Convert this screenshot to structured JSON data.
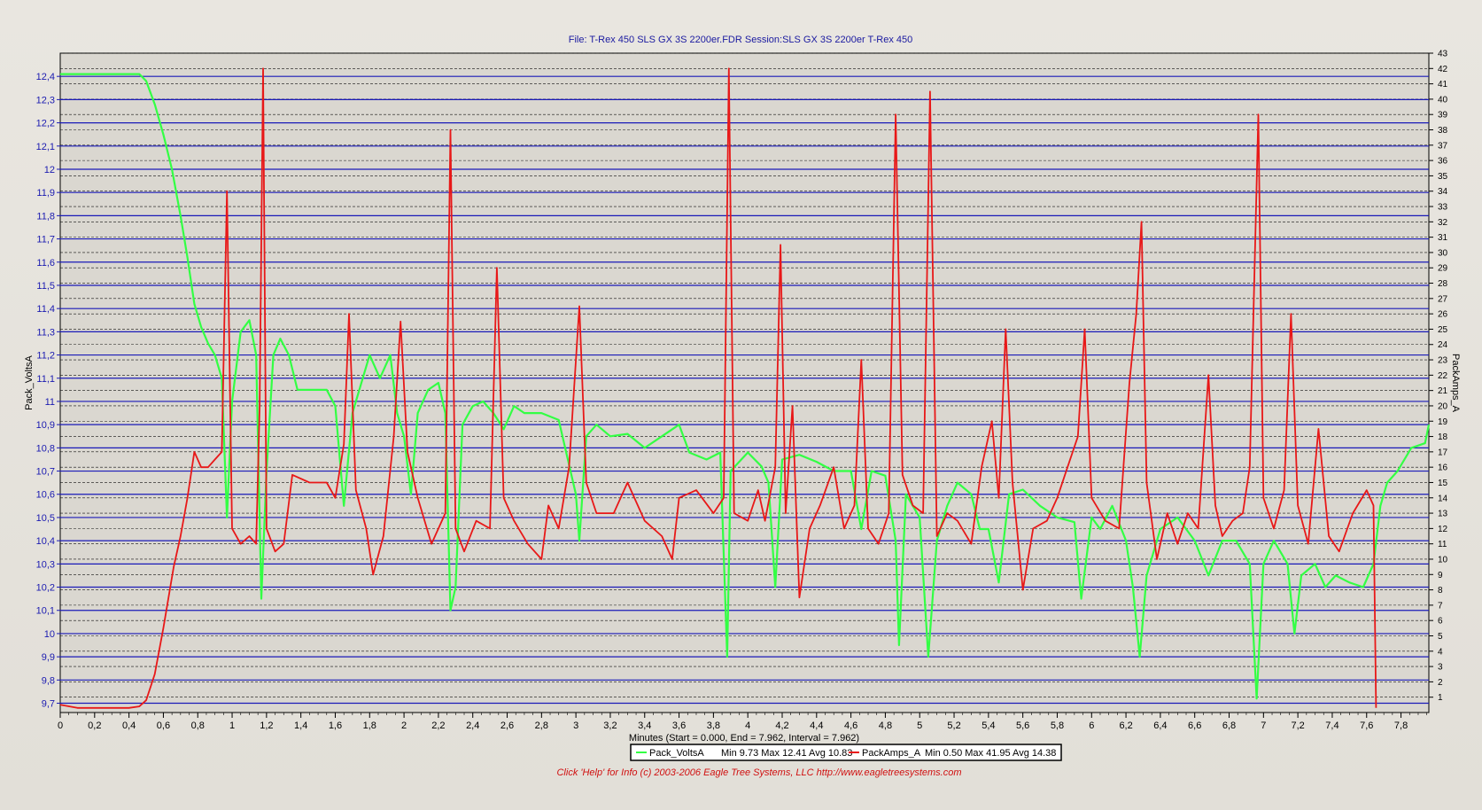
{
  "chart_data": {
    "type": "line",
    "title": "File: T-Rex 450 SLS GX 3S 2200er.FDR   Session:SLS GX 3S 2200er T-Rex 450",
    "xlabel": "Minutes (Start = 0.000,  End = 7.962,  Interval =  7.962)",
    "ylabel_left": "Pack_VoltsA",
    "ylabel_right": "PackAmps_A",
    "xlim": [
      0,
      7.962
    ],
    "ylim_left": [
      9.66,
      12.5
    ],
    "ylim_right": [
      0,
      43
    ],
    "x_ticks": [
      "0",
      "0,2",
      "0,4",
      "0,6",
      "0,8",
      "1",
      "1,2",
      "1,4",
      "1,6",
      "1,8",
      "2",
      "2,2",
      "2,4",
      "2,6",
      "2,8",
      "3",
      "3,2",
      "3,4",
      "3,6",
      "3,8",
      "4",
      "4,2",
      "4,4",
      "4,6",
      "4,8",
      "5",
      "5,2",
      "5,4",
      "5,6",
      "5,8",
      "6",
      "6,2",
      "6,4",
      "6,6",
      "6,8",
      "7",
      "7,2",
      "7,4",
      "7,6",
      "7,8"
    ],
    "y_left_ticks": [
      "12,4",
      "12,3",
      "12,2",
      "12,1",
      "12",
      "11,9",
      "11,8",
      "11,7",
      "11,6",
      "11,5",
      "11,4",
      "11,3",
      "11,2",
      "11,1",
      "11",
      "10,9",
      "10,8",
      "10,7",
      "10,6",
      "10,5",
      "10,4",
      "10,3",
      "10,2",
      "10,1",
      "10",
      "9,9",
      "9,8",
      "9,7"
    ],
    "y_right_ticks": [
      "43",
      "42",
      "41",
      "40",
      "39",
      "38",
      "37",
      "36",
      "35",
      "34",
      "33",
      "32",
      "31",
      "30",
      "29",
      "28",
      "27",
      "26",
      "25",
      "24",
      "23",
      "22",
      "21",
      "20",
      "19",
      "18",
      "17",
      "16",
      "15",
      "14",
      "13",
      "12",
      "11",
      "10",
      "9",
      "8",
      "7",
      "6",
      "5",
      "4",
      "3",
      "2",
      "1"
    ],
    "grid": true,
    "legend_position": "bottom-center",
    "series": [
      {
        "name": "Pack_VoltsA",
        "axis": "left",
        "color": "#33ff44",
        "stats": "Min 9.73 Max 12.41 Avg 10.83",
        "points": [
          [
            0,
            12.41
          ],
          [
            0.3,
            12.41
          ],
          [
            0.46,
            12.41
          ],
          [
            0.5,
            12.38
          ],
          [
            0.55,
            12.28
          ],
          [
            0.6,
            12.15
          ],
          [
            0.65,
            12.0
          ],
          [
            0.7,
            11.8
          ],
          [
            0.74,
            11.62
          ],
          [
            0.78,
            11.42
          ],
          [
            0.82,
            11.32
          ],
          [
            0.86,
            11.25
          ],
          [
            0.9,
            11.2
          ],
          [
            0.94,
            11.1
          ],
          [
            0.97,
            10.5
          ],
          [
            1.0,
            11.0
          ],
          [
            1.05,
            11.3
          ],
          [
            1.1,
            11.35
          ],
          [
            1.14,
            11.2
          ],
          [
            1.17,
            10.15
          ],
          [
            1.2,
            10.7
          ],
          [
            1.24,
            11.2
          ],
          [
            1.28,
            11.27
          ],
          [
            1.33,
            11.2
          ],
          [
            1.38,
            11.05
          ],
          [
            1.45,
            11.05
          ],
          [
            1.55,
            11.05
          ],
          [
            1.6,
            10.98
          ],
          [
            1.65,
            10.55
          ],
          [
            1.7,
            10.95
          ],
          [
            1.76,
            11.1
          ],
          [
            1.8,
            11.2
          ],
          [
            1.86,
            11.1
          ],
          [
            1.92,
            11.2
          ],
          [
            1.96,
            10.95
          ],
          [
            2.0,
            10.85
          ],
          [
            2.04,
            10.6
          ],
          [
            2.08,
            10.95
          ],
          [
            2.14,
            11.05
          ],
          [
            2.2,
            11.08
          ],
          [
            2.24,
            10.95
          ],
          [
            2.27,
            10.1
          ],
          [
            2.3,
            10.2
          ],
          [
            2.34,
            10.9
          ],
          [
            2.4,
            10.98
          ],
          [
            2.46,
            11.0
          ],
          [
            2.52,
            10.95
          ],
          [
            2.58,
            10.88
          ],
          [
            2.64,
            10.98
          ],
          [
            2.7,
            10.95
          ],
          [
            2.8,
            10.95
          ],
          [
            2.9,
            10.92
          ],
          [
            3.0,
            10.6
          ],
          [
            3.02,
            10.4
          ],
          [
            3.06,
            10.85
          ],
          [
            3.12,
            10.9
          ],
          [
            3.2,
            10.85
          ],
          [
            3.3,
            10.86
          ],
          [
            3.4,
            10.8
          ],
          [
            3.5,
            10.85
          ],
          [
            3.6,
            10.9
          ],
          [
            3.66,
            10.78
          ],
          [
            3.76,
            10.75
          ],
          [
            3.84,
            10.78
          ],
          [
            3.88,
            9.9
          ],
          [
            3.9,
            10.7
          ],
          [
            4.0,
            10.78
          ],
          [
            4.08,
            10.72
          ],
          [
            4.12,
            10.65
          ],
          [
            4.16,
            10.2
          ],
          [
            4.2,
            10.75
          ],
          [
            4.3,
            10.77
          ],
          [
            4.4,
            10.74
          ],
          [
            4.5,
            10.7
          ],
          [
            4.6,
            10.7
          ],
          [
            4.66,
            10.45
          ],
          [
            4.72,
            10.7
          ],
          [
            4.8,
            10.68
          ],
          [
            4.86,
            10.4
          ],
          [
            4.88,
            9.95
          ],
          [
            4.92,
            10.6
          ],
          [
            5.0,
            10.5
          ],
          [
            5.05,
            9.9
          ],
          [
            5.1,
            10.4
          ],
          [
            5.16,
            10.55
          ],
          [
            5.22,
            10.65
          ],
          [
            5.3,
            10.6
          ],
          [
            5.35,
            10.45
          ],
          [
            5.4,
            10.45
          ],
          [
            5.46,
            10.22
          ],
          [
            5.52,
            10.6
          ],
          [
            5.6,
            10.62
          ],
          [
            5.7,
            10.55
          ],
          [
            5.8,
            10.5
          ],
          [
            5.9,
            10.48
          ],
          [
            5.94,
            10.15
          ],
          [
            6.0,
            10.5
          ],
          [
            6.05,
            10.45
          ],
          [
            6.12,
            10.55
          ],
          [
            6.2,
            10.4
          ],
          [
            6.24,
            10.2
          ],
          [
            6.28,
            9.9
          ],
          [
            6.32,
            10.25
          ],
          [
            6.4,
            10.45
          ],
          [
            6.5,
            10.5
          ],
          [
            6.6,
            10.4
          ],
          [
            6.68,
            10.25
          ],
          [
            6.76,
            10.4
          ],
          [
            6.84,
            10.4
          ],
          [
            6.92,
            10.3
          ],
          [
            6.96,
            9.72
          ],
          [
            7.0,
            10.3
          ],
          [
            7.06,
            10.4
          ],
          [
            7.14,
            10.3
          ],
          [
            7.18,
            10.0
          ],
          [
            7.22,
            10.25
          ],
          [
            7.3,
            10.3
          ],
          [
            7.36,
            10.2
          ],
          [
            7.42,
            10.25
          ],
          [
            7.5,
            10.22
          ],
          [
            7.58,
            10.2
          ],
          [
            7.64,
            10.3
          ],
          [
            7.68,
            10.55
          ],
          [
            7.72,
            10.65
          ],
          [
            7.78,
            10.7
          ],
          [
            7.86,
            10.8
          ],
          [
            7.94,
            10.82
          ],
          [
            7.962,
            10.9
          ]
        ]
      },
      {
        "name": "PackAmps_A",
        "axis": "right",
        "color": "#e81818",
        "stats": "Min 0.50 Max 41.95 Avg 14.38",
        "points": [
          [
            0,
            0.5
          ],
          [
            0.1,
            0.3
          ],
          [
            0.2,
            0.3
          ],
          [
            0.3,
            0.3
          ],
          [
            0.4,
            0.3
          ],
          [
            0.46,
            0.4
          ],
          [
            0.5,
            0.8
          ],
          [
            0.55,
            2.5
          ],
          [
            0.6,
            5.5
          ],
          [
            0.66,
            9.5
          ],
          [
            0.7,
            11.5
          ],
          [
            0.74,
            14.0
          ],
          [
            0.78,
            17.0
          ],
          [
            0.82,
            16.0
          ],
          [
            0.86,
            16.0
          ],
          [
            0.9,
            16.5
          ],
          [
            0.94,
            17.0
          ],
          [
            0.97,
            34.0
          ],
          [
            1.0,
            12.0
          ],
          [
            1.05,
            11.0
          ],
          [
            1.1,
            11.5
          ],
          [
            1.14,
            11.0
          ],
          [
            1.16,
            20.0
          ],
          [
            1.18,
            42.0
          ],
          [
            1.2,
            12.0
          ],
          [
            1.25,
            10.5
          ],
          [
            1.3,
            11.0
          ],
          [
            1.35,
            15.5
          ],
          [
            1.45,
            15.0
          ],
          [
            1.55,
            15.0
          ],
          [
            1.6,
            14.0
          ],
          [
            1.65,
            17.5
          ],
          [
            1.68,
            26.0
          ],
          [
            1.72,
            14.5
          ],
          [
            1.78,
            12.0
          ],
          [
            1.82,
            9.0
          ],
          [
            1.88,
            11.5
          ],
          [
            1.94,
            18.0
          ],
          [
            1.98,
            25.5
          ],
          [
            2.02,
            17.0
          ],
          [
            2.08,
            14.0
          ],
          [
            2.16,
            11.0
          ],
          [
            2.24,
            13.0
          ],
          [
            2.27,
            38.0
          ],
          [
            2.3,
            12.0
          ],
          [
            2.35,
            10.5
          ],
          [
            2.42,
            12.5
          ],
          [
            2.5,
            12.0
          ],
          [
            2.54,
            29.0
          ],
          [
            2.58,
            14.0
          ],
          [
            2.64,
            12.5
          ],
          [
            2.72,
            11.0
          ],
          [
            2.8,
            10.0
          ],
          [
            2.84,
            13.5
          ],
          [
            2.9,
            12.0
          ],
          [
            2.96,
            16.0
          ],
          [
            3.02,
            26.5
          ],
          [
            3.06,
            15.0
          ],
          [
            3.12,
            13.0
          ],
          [
            3.22,
            13.0
          ],
          [
            3.3,
            15.0
          ],
          [
            3.4,
            12.5
          ],
          [
            3.5,
            11.5
          ],
          [
            3.56,
            10.0
          ],
          [
            3.6,
            14.0
          ],
          [
            3.7,
            14.5
          ],
          [
            3.8,
            13.0
          ],
          [
            3.86,
            14.0
          ],
          [
            3.89,
            42.0
          ],
          [
            3.92,
            13.0
          ],
          [
            4.0,
            12.5
          ],
          [
            4.06,
            14.5
          ],
          [
            4.1,
            12.5
          ],
          [
            4.16,
            16.0
          ],
          [
            4.19,
            30.5
          ],
          [
            4.22,
            13.0
          ],
          [
            4.26,
            20.0
          ],
          [
            4.3,
            7.5
          ],
          [
            4.36,
            12.0
          ],
          [
            4.42,
            13.5
          ],
          [
            4.5,
            16.0
          ],
          [
            4.56,
            12.0
          ],
          [
            4.62,
            13.5
          ],
          [
            4.66,
            23.0
          ],
          [
            4.7,
            12.0
          ],
          [
            4.76,
            11.0
          ],
          [
            4.82,
            13.0
          ],
          [
            4.86,
            39.0
          ],
          [
            4.9,
            15.5
          ],
          [
            4.96,
            13.5
          ],
          [
            5.02,
            13.0
          ],
          [
            5.06,
            40.5
          ],
          [
            5.1,
            11.5
          ],
          [
            5.16,
            13.0
          ],
          [
            5.22,
            12.5
          ],
          [
            5.3,
            11.0
          ],
          [
            5.36,
            16.0
          ],
          [
            5.42,
            19.0
          ],
          [
            5.46,
            14.0
          ],
          [
            5.5,
            25.0
          ],
          [
            5.54,
            15.0
          ],
          [
            5.6,
            8.0
          ],
          [
            5.66,
            12.0
          ],
          [
            5.74,
            12.5
          ],
          [
            5.8,
            14.0
          ],
          [
            5.86,
            16.0
          ],
          [
            5.92,
            18.0
          ],
          [
            5.96,
            25.0
          ],
          [
            6.0,
            14.0
          ],
          [
            6.08,
            12.5
          ],
          [
            6.16,
            12.0
          ],
          [
            6.22,
            21.5
          ],
          [
            6.26,
            26.0
          ],
          [
            6.29,
            32.0
          ],
          [
            6.32,
            15.0
          ],
          [
            6.38,
            10.0
          ],
          [
            6.44,
            13.0
          ],
          [
            6.5,
            11.0
          ],
          [
            6.56,
            13.0
          ],
          [
            6.62,
            12.0
          ],
          [
            6.68,
            22.0
          ],
          [
            6.72,
            13.5
          ],
          [
            6.76,
            11.5
          ],
          [
            6.82,
            12.5
          ],
          [
            6.88,
            13.0
          ],
          [
            6.92,
            16.0
          ],
          [
            6.97,
            39.0
          ],
          [
            7.0,
            14.0
          ],
          [
            7.06,
            12.0
          ],
          [
            7.12,
            14.5
          ],
          [
            7.16,
            26.0
          ],
          [
            7.2,
            13.5
          ],
          [
            7.26,
            11.0
          ],
          [
            7.32,
            18.5
          ],
          [
            7.38,
            11.5
          ],
          [
            7.44,
            10.5
          ],
          [
            7.52,
            13.0
          ],
          [
            7.6,
            14.5
          ],
          [
            7.64,
            13.5
          ],
          [
            7.655,
            0.3
          ]
        ]
      }
    ]
  },
  "footer": {
    "credit": "Click 'Help' for Info  (c) 2003-2006 Eagle Tree Systems, LLC     http://www.eagletreesystems.com"
  }
}
